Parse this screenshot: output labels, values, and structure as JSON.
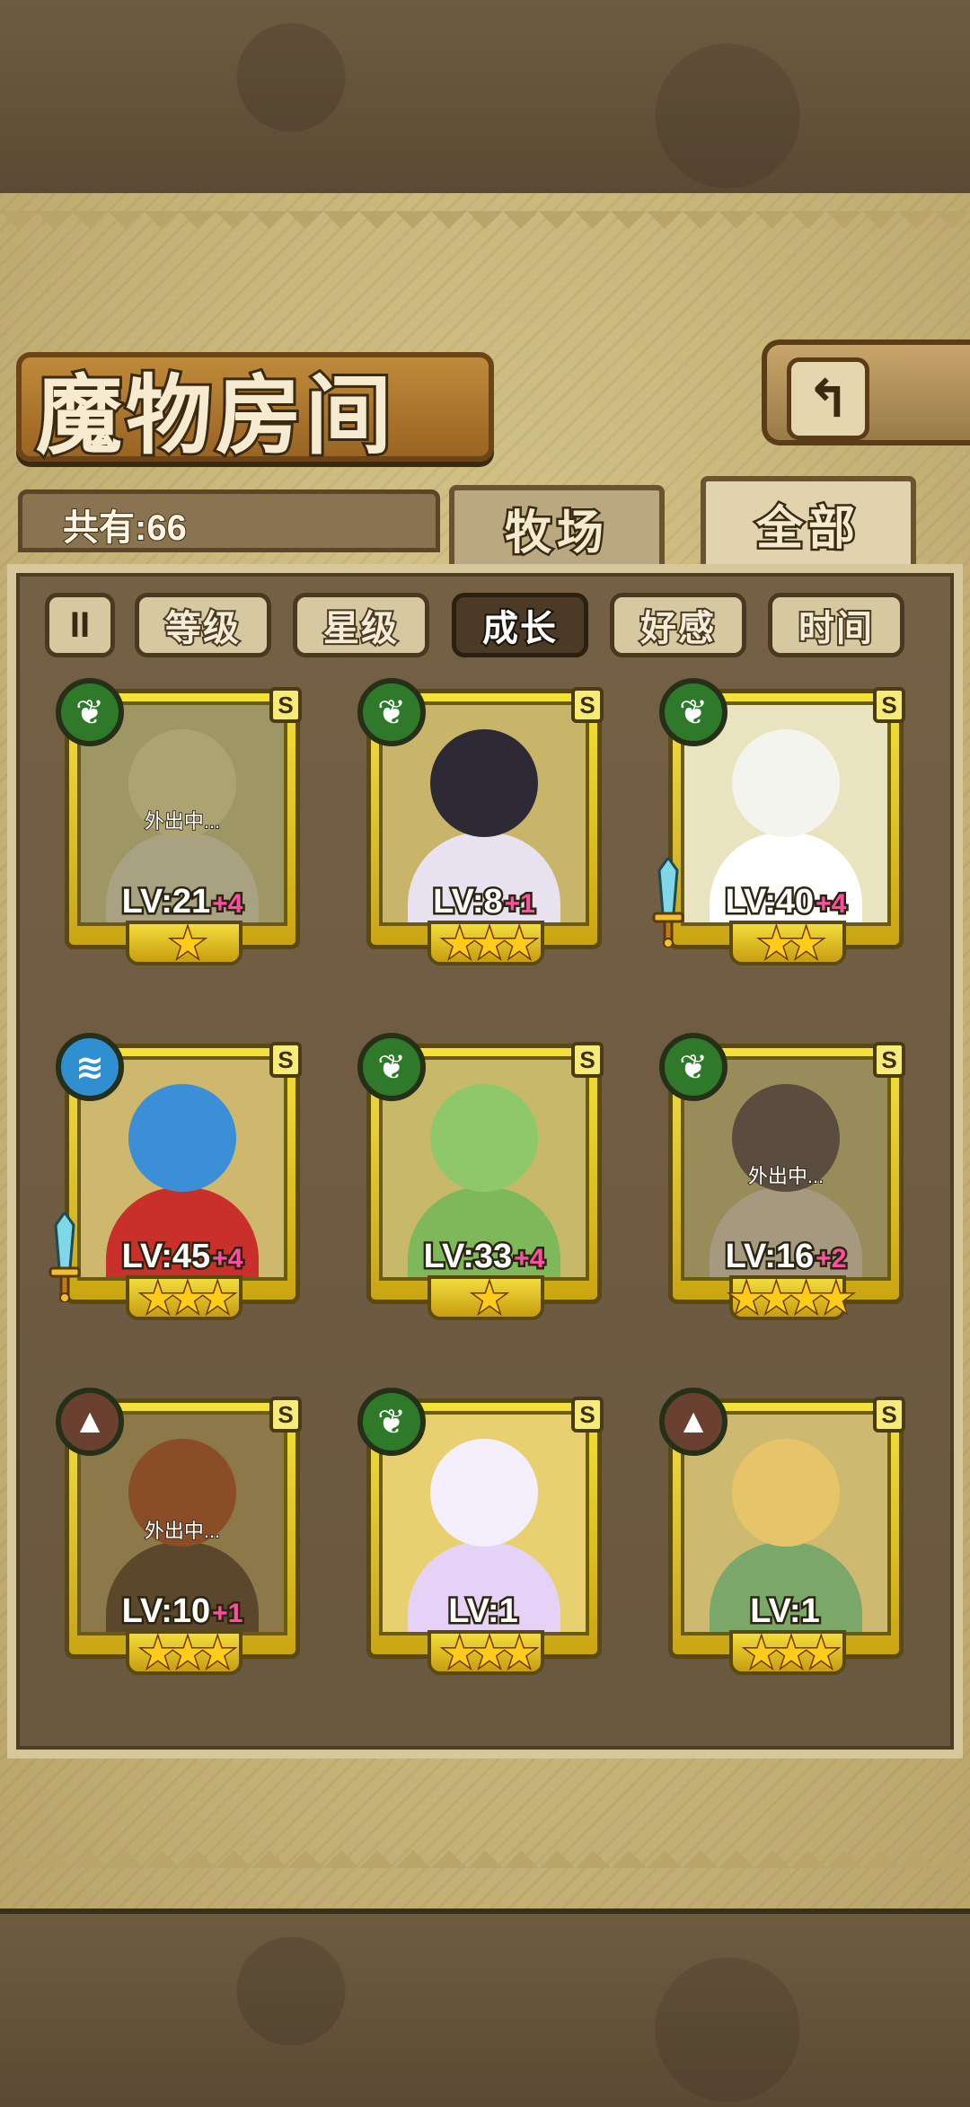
{
  "header": {
    "title": "魔物房间",
    "back_icon": "↰"
  },
  "summary": {
    "count_label": "共有:66"
  },
  "tabs": [
    {
      "label": "牧场",
      "active": false
    },
    {
      "label": "全部",
      "active": true
    }
  ],
  "sort": {
    "toggle_icon": "II",
    "buttons": [
      {
        "label": "等级",
        "active": false
      },
      {
        "label": "星级",
        "active": false
      },
      {
        "label": "成长",
        "active": true
      },
      {
        "label": "好感",
        "active": false
      },
      {
        "label": "时间",
        "active": false
      }
    ]
  },
  "monsters": [
    {
      "level": "LV:21",
      "bonus": "+4",
      "stars": "★",
      "element": "leaf",
      "rank": "S",
      "status": "外出中...",
      "weapon": false,
      "colors": {
        "bg": "#d8cf9a",
        "hair": "#f0e7b0",
        "body": "#e7e4cc"
      }
    },
    {
      "level": "LV:8",
      "bonus": "+1",
      "stars": "★★★",
      "element": "leaf",
      "rank": "S",
      "status": "",
      "weapon": false,
      "colors": {
        "bg": "#c9b56a",
        "hair": "#2d2a35",
        "body": "#e8e2f0"
      }
    },
    {
      "level": "LV:40",
      "bonus": "+4",
      "stars": "★★",
      "element": "leaf",
      "rank": "S",
      "status": "",
      "weapon": true,
      "colors": {
        "bg": "#e9e3bf",
        "hair": "#f4f4ee",
        "body": "#ffffff"
      }
    },
    {
      "level": "LV:45",
      "bonus": "+4",
      "stars": "★★★",
      "element": "water",
      "rank": "S",
      "status": "",
      "weapon": true,
      "colors": {
        "bg": "#cdb86e",
        "hair": "#3b8fd6",
        "body": "#c9302c"
      }
    },
    {
      "level": "LV:33",
      "bonus": "+4",
      "stars": "★",
      "element": "leaf",
      "rank": "S",
      "status": "",
      "weapon": false,
      "colors": {
        "bg": "#c8b96a",
        "hair": "#8fc86a",
        "body": "#7fb85a"
      }
    },
    {
      "level": "LV:16",
      "bonus": "+2",
      "stars": "★★★★",
      "element": "leaf",
      "rank": "S",
      "status": "外出中...",
      "weapon": false,
      "colors": {
        "bg": "#cbbd86",
        "hair": "#5a4a50",
        "body": "#e2d8c8"
      }
    },
    {
      "level": "LV:10",
      "bonus": "+1",
      "stars": "★★★",
      "element": "earth",
      "rank": "S",
      "status": "外出中...",
      "weapon": false,
      "colors": {
        "bg": "#b79a64",
        "hair": "#b24a28",
        "body": "#5a4030"
      }
    },
    {
      "level": "LV:1",
      "bonus": "",
      "stars": "★★★",
      "element": "leaf",
      "rank": "S",
      "status": "",
      "weapon": false,
      "colors": {
        "bg": "#e8d070",
        "hair": "#f5eefc",
        "body": "#e6d2f6"
      }
    },
    {
      "level": "LV:1",
      "bonus": "",
      "stars": "★★★",
      "element": "earth",
      "rank": "S",
      "status": "",
      "weapon": false,
      "colors": {
        "bg": "#cdb970",
        "hair": "#e6c56a",
        "body": "#7ba86a"
      }
    }
  ],
  "element_icons": {
    "leaf": "❦",
    "water": "≋",
    "earth": "▲"
  }
}
